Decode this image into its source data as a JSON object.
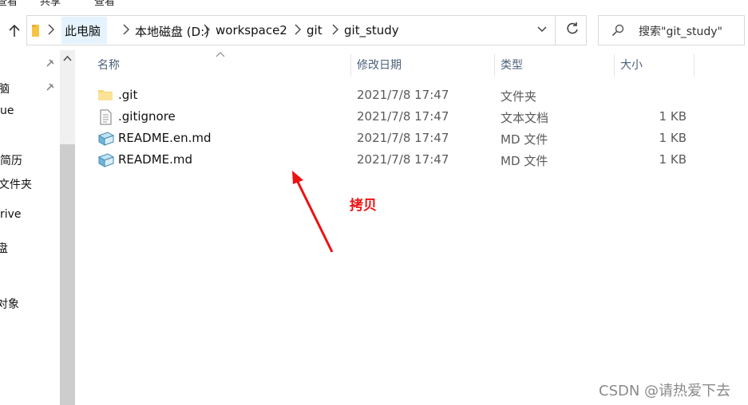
{
  "ribbon": {
    "tabs": [
      "查看",
      "共享",
      "查看"
    ]
  },
  "address_bar": {
    "breadcrumbs": [
      "此电脑",
      "本地磁盘 (D:)",
      "workspace2",
      "git",
      "git_study"
    ]
  },
  "search": {
    "placeholder": "搜索\"git_study\""
  },
  "nav_pane": {
    "items": [
      "脑",
      "ue",
      "简历",
      "文件夹",
      "rive",
      "盘",
      "对象"
    ]
  },
  "columns": {
    "name": "名称",
    "date": "修改日期",
    "type": "类型",
    "size": "大小"
  },
  "files": [
    {
      "name": ".git",
      "date": "2021/7/8 17:47",
      "type": "文件夹",
      "size": "",
      "icon": "folder-icon"
    },
    {
      "name": ".gitignore",
      "date": "2021/7/8 17:47",
      "type": "文本文档",
      "size": "1 KB",
      "icon": "text-file-icon"
    },
    {
      "name": "README.en.md",
      "date": "2021/7/8 17:47",
      "type": "MD 文件",
      "size": "1 KB",
      "icon": "md-file-icon"
    },
    {
      "name": "README.md",
      "date": "2021/7/8 17:47",
      "type": "MD 文件",
      "size": "1 KB",
      "icon": "md-file-icon"
    }
  ],
  "annotation": {
    "text": "拷贝",
    "color": "#ee1111"
  },
  "watermark": "CSDN @请热爱下去",
  "colors": {
    "header_text": "#4c607a",
    "breadcrumb_highlight": "#e5f3ff",
    "arrow": "#ee1111"
  }
}
